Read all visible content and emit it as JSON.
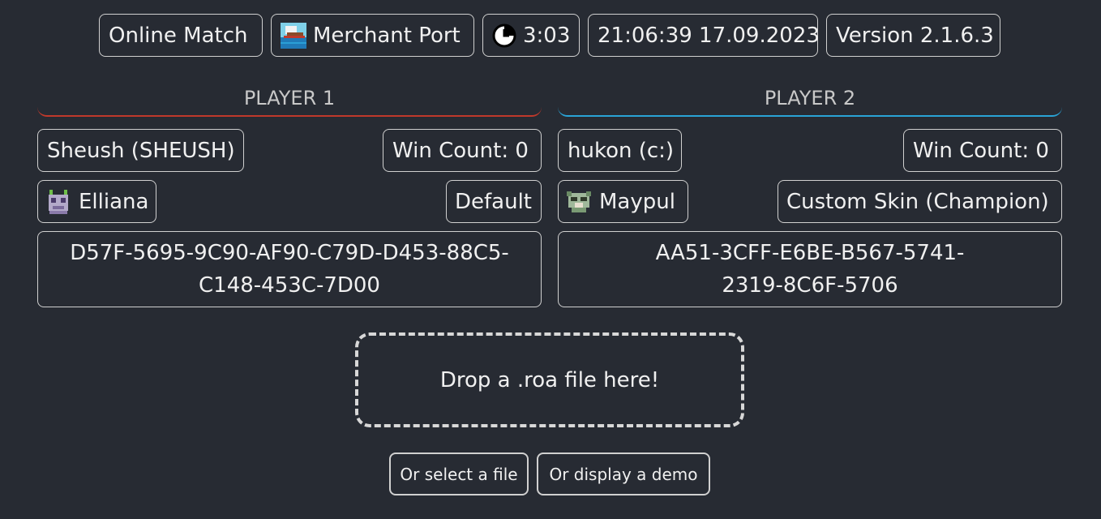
{
  "header": {
    "match_type": "Online Match",
    "stage": {
      "name": "Merchant Port",
      "icon": "merchant-port-stage-icon"
    },
    "timer": {
      "value": "3:03",
      "icon": "clock-icon"
    },
    "datetime": "21:06:39 17.09.2023",
    "version": "Version 2.1.6.3"
  },
  "players": [
    {
      "heading": "PLAYER 1",
      "accent": "#c0392b",
      "name": "Sheush (SHEUSH)",
      "win_count": "Win Count: 0",
      "character": {
        "name": "Elliana",
        "icon": "elliana-character-icon"
      },
      "skin": "Default",
      "code": "D57F-5695-9C90-AF90-C79D-D453-88C5-C148-453C-7D00"
    },
    {
      "heading": "PLAYER 2",
      "accent": "#29a3d6",
      "name": "hukon (c:)",
      "win_count": "Win Count: 0",
      "character": {
        "name": "Maypul",
        "icon": "maypul-character-icon"
      },
      "skin": "Custom Skin (Champion)",
      "code": "AA51-3CFF-E6BE-B567-5741-2319-8C6F-5706"
    }
  ],
  "dropzone": {
    "label": "Drop a .roa file here!"
  },
  "actions": {
    "select_file": "Or select a file",
    "display_demo": "Or display a demo"
  }
}
